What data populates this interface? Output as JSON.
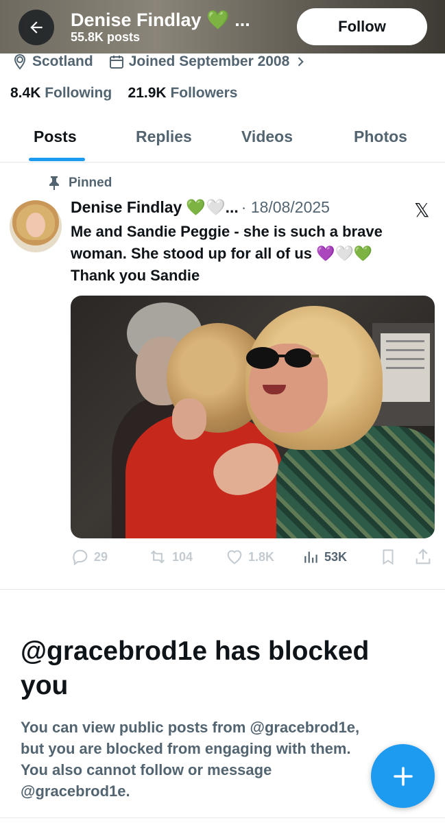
{
  "header": {
    "name": "Denise Findlay",
    "name_emoji": "💚",
    "name_ellipsis": "...",
    "post_count": "55.8K posts",
    "follow_label": "Follow"
  },
  "profile": {
    "location": "Scotland",
    "joined": "Joined September 2008",
    "following_count": "8.4K",
    "following_label": "Following",
    "followers_count": "21.9K",
    "followers_label": "Followers"
  },
  "tabs": [
    {
      "label": "Posts",
      "active": true
    },
    {
      "label": "Replies",
      "active": false
    },
    {
      "label": "Videos",
      "active": false
    },
    {
      "label": "Photos",
      "active": false
    }
  ],
  "pinned_post": {
    "pinned_label": "Pinned",
    "author": "Denise Findlay",
    "author_emoji": "💚🤍...",
    "date": "· 18/08/2025",
    "text_line1": "Me and Sandie Peggie - she is such a brave",
    "text_line2": "woman.  She stood up for all of us 💜🤍💚",
    "text_line3": "Thank you Sandie",
    "replies": "29",
    "reposts": "104",
    "likes": "1.8K",
    "views": "53K"
  },
  "blocked": {
    "title_line1": "@gracebrod1e has blocked",
    "title_line2": "you",
    "text_line1": "You can view public posts from @gracebrod1e,",
    "text_line2": "but you are blocked from engaging with them.",
    "text_line3": "You also cannot follow or message",
    "text_line4": "@gracebrod1e."
  },
  "colors": {
    "accent": "#1d9bf0",
    "text_primary": "#0f1419",
    "text_secondary": "#536471",
    "heart_green": "#3cc33c"
  },
  "icons": [
    "back-arrow-icon",
    "location-pin-icon",
    "calendar-icon",
    "chevron-right-icon",
    "pin-icon",
    "x-logo-icon",
    "reply-icon",
    "repost-icon",
    "like-icon",
    "views-icon",
    "bookmark-icon",
    "share-icon",
    "plus-icon"
  ]
}
